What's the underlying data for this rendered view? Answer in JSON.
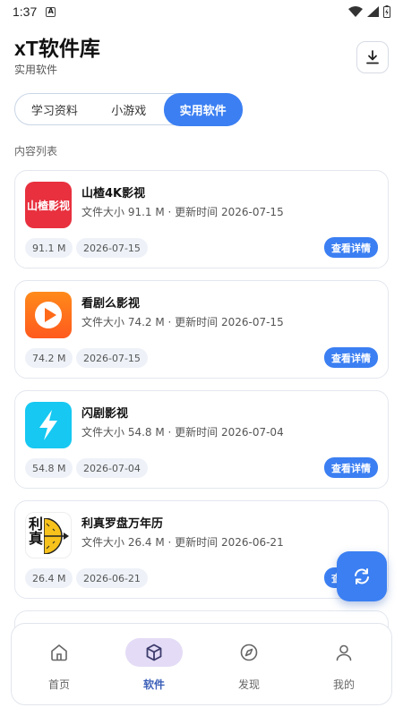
{
  "status_bar": {
    "time": "1:37",
    "notif_glyph": "A"
  },
  "header": {
    "title": "xT软件库",
    "subtitle": "实用软件",
    "download_icon": "download-icon"
  },
  "tabs": [
    {
      "label": "学习资料",
      "active": false
    },
    {
      "label": "小游戏",
      "active": false
    },
    {
      "label": "实用软件",
      "active": true
    }
  ],
  "section_label": "内容列表",
  "items": [
    {
      "name": "山楂4K影视",
      "meta": "文件大小 91.1 M · 更新时间 2026-07-15",
      "size": "91.1 M",
      "date": "2026-07-15",
      "button": "查看详情",
      "icon_text": "山楂影视",
      "icon_color": "#e8303e"
    },
    {
      "name": "看剧么影视",
      "meta": "文件大小 74.2 M · 更新时间 2026-07-15",
      "size": "74.2 M",
      "date": "2026-07-15",
      "button": "查看详情",
      "icon_color": "#ff6a1a"
    },
    {
      "name": "闪剧影视",
      "meta": "文件大小 54.8 M · 更新时间 2026-07-04",
      "size": "54.8 M",
      "date": "2026-07-04",
      "button": "查看详情",
      "icon_color": "#16c8f2"
    },
    {
      "name": "利真罗盘万年历",
      "meta": "文件大小 26.4 M · 更新时间 2026-06-21",
      "size": "26.4 M",
      "date": "2026-06-21",
      "button": "查看详情",
      "icon_text": "利真",
      "icon_color": "#f7c21b"
    }
  ],
  "fab": {
    "icon": "refresh-icon"
  },
  "bottom_nav": [
    {
      "label": "首页",
      "icon": "home-icon",
      "active": false
    },
    {
      "label": "软件",
      "icon": "box-icon",
      "active": true
    },
    {
      "label": "发现",
      "icon": "compass-icon",
      "active": false
    },
    {
      "label": "我的",
      "icon": "user-icon",
      "active": false
    }
  ],
  "colors": {
    "accent": "#3b7ff2",
    "nav_active_bg": "#e4dcf6"
  }
}
